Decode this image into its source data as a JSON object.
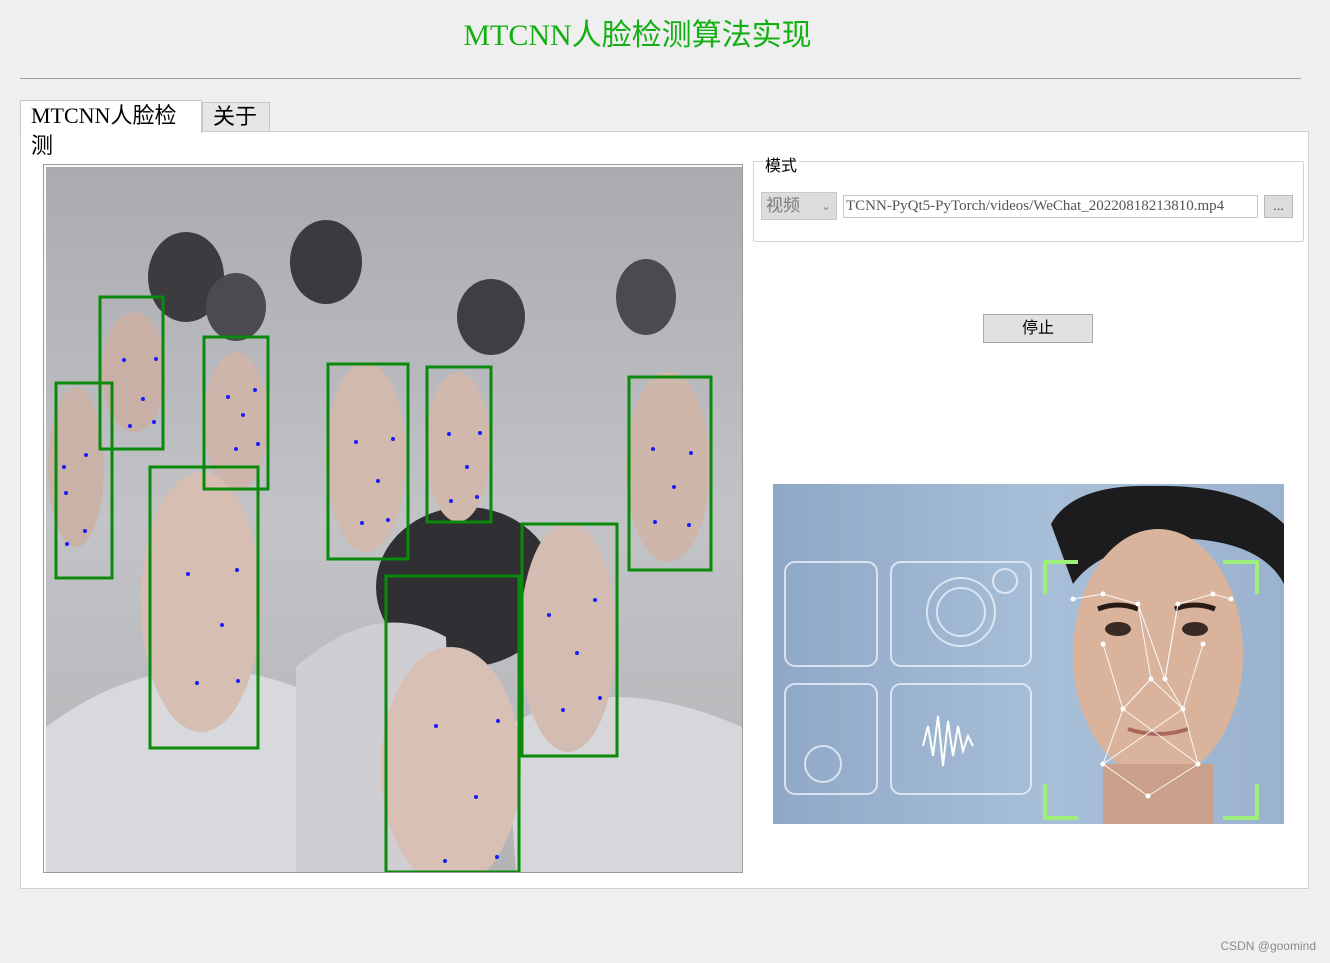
{
  "window": {
    "title": "MTCNN人脸检测算法实现"
  },
  "tabs": [
    {
      "label": "MTCNN人脸检测",
      "active": true
    },
    {
      "label": "关于",
      "active": false
    }
  ],
  "mode_group": {
    "legend": "模式",
    "mode_select": {
      "selected": "视频"
    },
    "path_value": "TCNN-PyQt5-PyTorch/videos/WeChat_20220818213810.mp4",
    "browse_label": "..."
  },
  "controls": {
    "stop_label": "停止"
  },
  "footer": {
    "watermark": "CSDN @goomind"
  },
  "colors": {
    "title": "#12b012",
    "detection_box": "#0a8a0a",
    "landmark": "#1a1aff",
    "panel_bg": "#ffffff",
    "window_bg": "#efefef"
  },
  "icons": {
    "select_arrow": "chevron-down-icon"
  }
}
